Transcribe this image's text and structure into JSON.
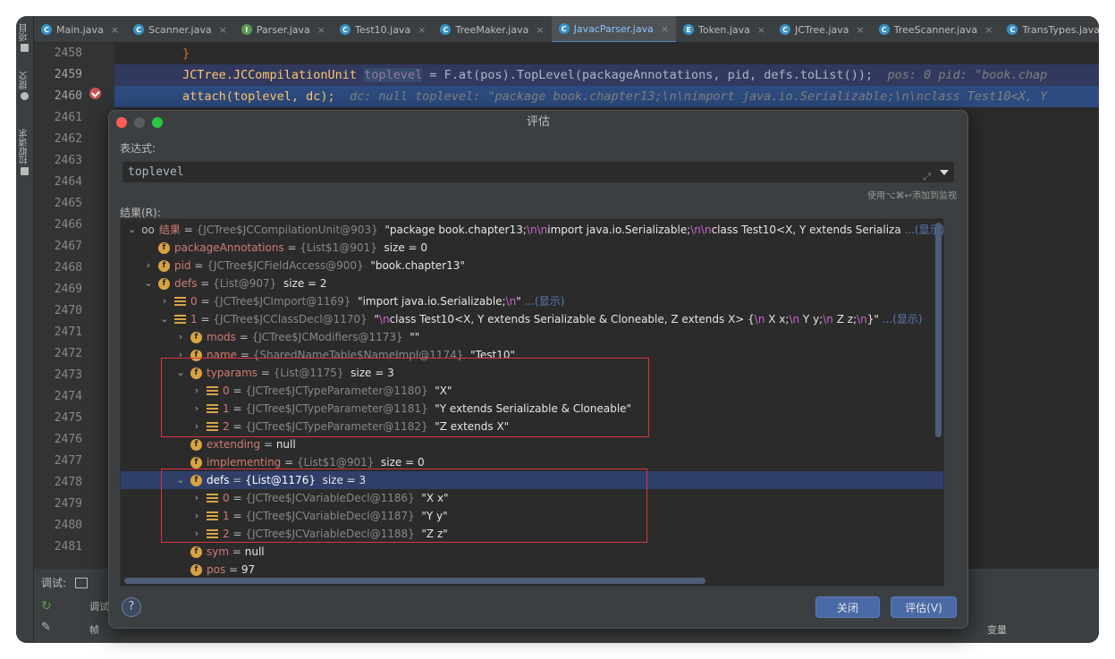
{
  "sidebar": {
    "items": [
      "项目",
      "提交",
      "拉取请求"
    ]
  },
  "tabs": [
    {
      "label": "Main.java",
      "icon": "C"
    },
    {
      "label": "Scanner.java",
      "icon": "C"
    },
    {
      "label": "Parser.java",
      "icon": "I"
    },
    {
      "label": "Test10.java",
      "icon": "C"
    },
    {
      "label": "TreeMaker.java",
      "icon": "C"
    },
    {
      "label": "JavacParser.java",
      "icon": "C"
    },
    {
      "label": "Token.java",
      "icon": "E"
    },
    {
      "label": "JCTree.java",
      "icon": "C"
    },
    {
      "label": "TreeScanner.java",
      "icon": "C"
    },
    {
      "label": "TransTypes.java",
      "icon": "C"
    }
  ],
  "line_numbers": [
    "2458",
    "2459",
    "2460",
    "2461",
    "2462",
    "2463",
    "2464",
    "2465",
    "2466",
    "2467",
    "2468",
    "2469",
    "2470",
    "2471",
    "2472",
    "2473",
    "2474",
    "2475",
    "2476",
    "2477",
    "2478",
    "2479",
    "2480",
    "2481"
  ],
  "code": {
    "l1": "}",
    "l2_type": "JCTree.JCCompilationUnit",
    "l2_var": "toplevel",
    "l2_rest": " = F.at(pos).TopLevel(packageAnnotations, pid, defs.toList());",
    "l2_hint": "pos: 0    pid: \"book.chap",
    "l3": "attach(toplevel, dc);",
    "l3_hint": "dc: null    toplevel: \"package book.chapter13;\\n\\nimport java.io.Serializable;\\n\\nclass Test10<X, Y"
  },
  "bottom": {
    "debug_label": "调试:",
    "debugger_tab": "调试器",
    "frames_label": "帧",
    "variables_label": "变量"
  },
  "dialog": {
    "title": "评估",
    "expr_label": "表达式:",
    "expression": "toplevel",
    "watch_hint": "使用⌥⌘↩添加到监视",
    "result_label": "结果(R):",
    "close_button": "关闭",
    "evaluate_button": "评估(V)",
    "help": "?"
  },
  "tree": [
    {
      "indent": 0,
      "arrow": "v",
      "icon": "glasses",
      "name": "结果",
      "type": "{JCTree$JCCompilationUnit@903}",
      "value": "\"package book.chapter13;\\n\\nimport java.io.Serializable;\\n\\nclass Test10<X, Y extends Serializa",
      "show": "...(显示)"
    },
    {
      "indent": 1,
      "arrow": "",
      "icon": "f",
      "name": "packageAnnotations",
      "type": "{List$1@901}",
      "value": "size = 0",
      "show": ""
    },
    {
      "indent": 1,
      "arrow": ">",
      "icon": "f",
      "name": "pid",
      "type": "{JCTree$JCFieldAccess@900}",
      "value": "\"book.chapter13\"",
      "show": ""
    },
    {
      "indent": 1,
      "arrow": "v",
      "icon": "f",
      "name": "defs",
      "type": "{List@907}",
      "value": "size = 2",
      "show": ""
    },
    {
      "indent": 2,
      "arrow": ">",
      "icon": "list",
      "name": "0",
      "type": "{JCTree$JCImport@1169}",
      "value": "\"import java.io.Serializable;\\n\"",
      "show": "...(显示)"
    },
    {
      "indent": 2,
      "arrow": "v",
      "icon": "list",
      "name": "1",
      "type": "{JCTree$JCClassDecl@1170}",
      "value": "\"\\nclass Test10<X, Y extends Serializable & Cloneable, Z extends X> {\\n    X x;\\n    Y y;\\n    Z z;\\n}\"",
      "show": "...(显示)"
    },
    {
      "indent": 3,
      "arrow": ">",
      "icon": "f",
      "name": "mods",
      "type": "{JCTree$JCModifiers@1173}",
      "value": "\"\"",
      "show": ""
    },
    {
      "indent": 3,
      "arrow": ">",
      "icon": "f",
      "name": "name",
      "type": "{SharedNameTable$NameImpl@1174}",
      "value": "\"Test10\"",
      "show": ""
    },
    {
      "indent": 3,
      "arrow": "v",
      "icon": "f",
      "name": "typarams",
      "type": "{List@1175}",
      "value": "size = 3",
      "show": ""
    },
    {
      "indent": 4,
      "arrow": ">",
      "icon": "list",
      "name": "0",
      "type": "{JCTree$JCTypeParameter@1180}",
      "value": "\"X\"",
      "show": ""
    },
    {
      "indent": 4,
      "arrow": ">",
      "icon": "list",
      "name": "1",
      "type": "{JCTree$JCTypeParameter@1181}",
      "value": "\"Y extends Serializable & Cloneable\"",
      "show": ""
    },
    {
      "indent": 4,
      "arrow": ">",
      "icon": "list",
      "name": "2",
      "type": "{JCTree$JCTypeParameter@1182}",
      "value": "\"Z extends X\"",
      "show": ""
    },
    {
      "indent": 3,
      "arrow": "",
      "icon": "f",
      "name": "extending",
      "type": "",
      "value": "null",
      "show": ""
    },
    {
      "indent": 3,
      "arrow": "",
      "icon": "f",
      "name": "implementing",
      "type": "{List$1@901}",
      "value": "size = 0",
      "show": ""
    },
    {
      "indent": 3,
      "arrow": "v",
      "icon": "f",
      "name": "defs",
      "type": "{List@1176}",
      "value": "size = 3",
      "show": "",
      "selected": true
    },
    {
      "indent": 4,
      "arrow": ">",
      "icon": "list",
      "name": "0",
      "type": "{JCTree$JCVariableDecl@1186}",
      "value": "\"X x\"",
      "show": ""
    },
    {
      "indent": 4,
      "arrow": ">",
      "icon": "list",
      "name": "1",
      "type": "{JCTree$JCVariableDecl@1187}",
      "value": "\"Y y\"",
      "show": ""
    },
    {
      "indent": 4,
      "arrow": ">",
      "icon": "list",
      "name": "2",
      "type": "{JCTree$JCVariableDecl@1188}",
      "value": "\"Z z\"",
      "show": ""
    },
    {
      "indent": 3,
      "arrow": "",
      "icon": "f",
      "name": "sym",
      "type": "",
      "value": "null",
      "show": ""
    },
    {
      "indent": 3,
      "arrow": "",
      "icon": "f",
      "name": "pos",
      "type": "",
      "value": "97",
      "show": ""
    }
  ],
  "colors": {
    "accent": "#4a88c7",
    "highlight_box": "#d9363e",
    "field_icon": "#d9a343"
  }
}
